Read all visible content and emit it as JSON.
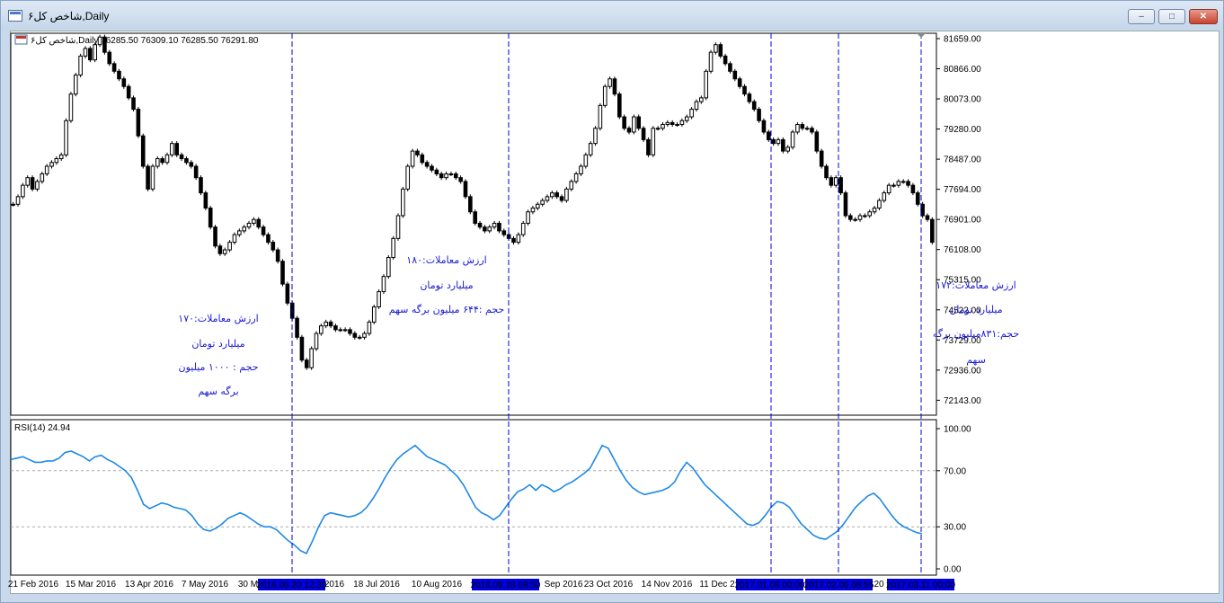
{
  "window": {
    "title": "شاخص کل۶,Daily",
    "buttons": {
      "minimize": "‒",
      "maximize": "□",
      "close": "✕"
    }
  },
  "chart_data": [
    {
      "type": "candlestick",
      "title": "شاخص کل۶,Daily",
      "ohlc_header": "76285.50 76309.10 76285.50 76291.80",
      "ylim": [
        71750,
        81800
      ],
      "y_ticks": [
        81659.0,
        80866.0,
        80073.0,
        79280.0,
        78487.0,
        77694.0,
        76901.0,
        76108.0,
        75315.0,
        74522.0,
        73729.0,
        72936.0,
        72143.0
      ],
      "x_tick_labels": [
        "21 Feb 2016",
        "15 Mar 2016",
        "13 Apr 2016",
        "7 May 2016",
        "30 M",
        "2016",
        "18 Jul 2016",
        "10 Aug 2016",
        "Sep 2016",
        "23 Oct 2016",
        "14 Nov 2016",
        "11 Dec 2",
        "20"
      ],
      "vertical_markers": [
        "2016.06.20 12:30",
        "2016.09.18 08:50",
        "2017.01.08 00:00",
        "2017.02.06 08:55",
        "2017.03.11 00:00"
      ],
      "close_values": [
        77300,
        77500,
        77800,
        78000,
        77700,
        77900,
        78100,
        78300,
        78400,
        78500,
        78600,
        79500,
        80200,
        80700,
        81200,
        81400,
        81100,
        81500,
        81700,
        81300,
        81000,
        80800,
        80600,
        80400,
        80100,
        79800,
        79100,
        78300,
        77700,
        78300,
        78500,
        78400,
        78600,
        78900,
        78600,
        78500,
        78400,
        78300,
        78000,
        77600,
        77200,
        76700,
        76200,
        76000,
        76100,
        76300,
        76500,
        76600,
        76700,
        76800,
        76900,
        76700,
        76500,
        76300,
        76100,
        75800,
        75200,
        74700,
        74300,
        73800,
        73200,
        73000,
        73500,
        73900,
        74100,
        74200,
        74100,
        74000,
        74000,
        74000,
        73900,
        73800,
        73800,
        73900,
        74200,
        74600,
        75000,
        75400,
        75900,
        76400,
        77000,
        77700,
        78300,
        78700,
        78600,
        78400,
        78300,
        78200,
        78100,
        78000,
        78100,
        78100,
        78000,
        77900,
        77500,
        77100,
        76800,
        76700,
        76600,
        76700,
        76800,
        76600,
        76500,
        76400,
        76300,
        76500,
        76800,
        77100,
        77200,
        77300,
        77400,
        77500,
        77600,
        77500,
        77400,
        77700,
        77900,
        78100,
        78300,
        78600,
        78900,
        79300,
        79900,
        80400,
        80600,
        80200,
        79600,
        79300,
        79200,
        79600,
        79300,
        79000,
        78600,
        79300,
        79300,
        79400,
        79450,
        79400,
        79400,
        79500,
        79600,
        79800,
        80000,
        80100,
        80800,
        81300,
        81500,
        81200,
        81000,
        80800,
        80600,
        80400,
        80200,
        80000,
        79800,
        79500,
        79200,
        79000,
        78900,
        79000,
        78700,
        78800,
        79200,
        79400,
        79300,
        79300,
        79200,
        78700,
        78300,
        78000,
        77800,
        78000,
        77600,
        77000,
        76900,
        76900,
        77000,
        77000,
        77100,
        77200,
        77400,
        77600,
        77800,
        77800,
        77900,
        77900,
        77800,
        77600,
        77300,
        77000,
        76900,
        76300
      ]
    },
    {
      "type": "line",
      "title": "RSI(14) 24.94",
      "series": [
        {
          "name": "RSI(14)",
          "values": [
            78,
            79,
            80,
            78,
            76,
            76,
            77,
            77,
            79,
            83,
            84,
            82,
            80,
            77,
            80,
            81,
            78,
            76,
            73,
            70,
            65,
            56,
            46,
            43,
            45,
            47,
            46,
            44,
            43,
            42,
            38,
            32,
            28,
            27,
            29,
            32,
            36,
            38,
            40,
            38,
            35,
            32,
            30,
            30,
            28,
            24,
            20,
            17,
            13,
            11,
            20,
            30,
            38,
            40,
            39,
            38,
            37,
            38,
            40,
            44,
            50,
            57,
            65,
            72,
            78,
            82,
            85,
            88,
            84,
            80,
            78,
            76,
            74,
            70,
            66,
            60,
            52,
            44,
            40,
            38,
            35,
            38,
            44,
            50,
            55,
            57,
            60,
            56,
            60,
            58,
            55,
            57,
            60,
            62,
            65,
            68,
            72,
            80,
            88,
            86,
            78,
            70,
            63,
            58,
            55,
            53,
            54,
            55,
            56,
            58,
            62,
            70,
            76,
            72,
            66,
            60,
            56,
            52,
            48,
            44,
            40,
            36,
            32,
            31,
            33,
            38,
            44,
            48,
            47,
            44,
            38,
            32,
            28,
            24,
            22,
            21,
            24,
            27,
            32,
            38,
            44,
            48,
            52,
            54,
            50,
            44,
            38,
            33,
            30,
            28,
            26,
            25
          ]
        }
      ],
      "ylim": [
        0,
        100
      ],
      "y_ticks": [
        100.0,
        70.0,
        30.0,
        0.0
      ],
      "levels": [
        70,
        30
      ]
    }
  ],
  "annotations": [
    {
      "lines": [
        "ارزش معاملات:۱۷۰",
        "میلیارد تومان",
        "حجم :    ۱۰۰۰ میلیون",
        "برگه سهم"
      ]
    },
    {
      "lines": [
        "ارزش معاملات:۱۸۰",
        "میلیارد تومان",
        "حجم :۶۴۴ میلیون برگه سهم"
      ]
    },
    {
      "lines": [
        "ارزش معاملات:۱۷۲",
        "میلیارد تومان",
        "حجم:۸۳۱میلیون برگه",
        "سهم"
      ]
    }
  ],
  "colors": {
    "marker": "#0000dd",
    "rsi": "#1e88e5",
    "candle": "#000000",
    "annotation": "#1a1ad6"
  }
}
